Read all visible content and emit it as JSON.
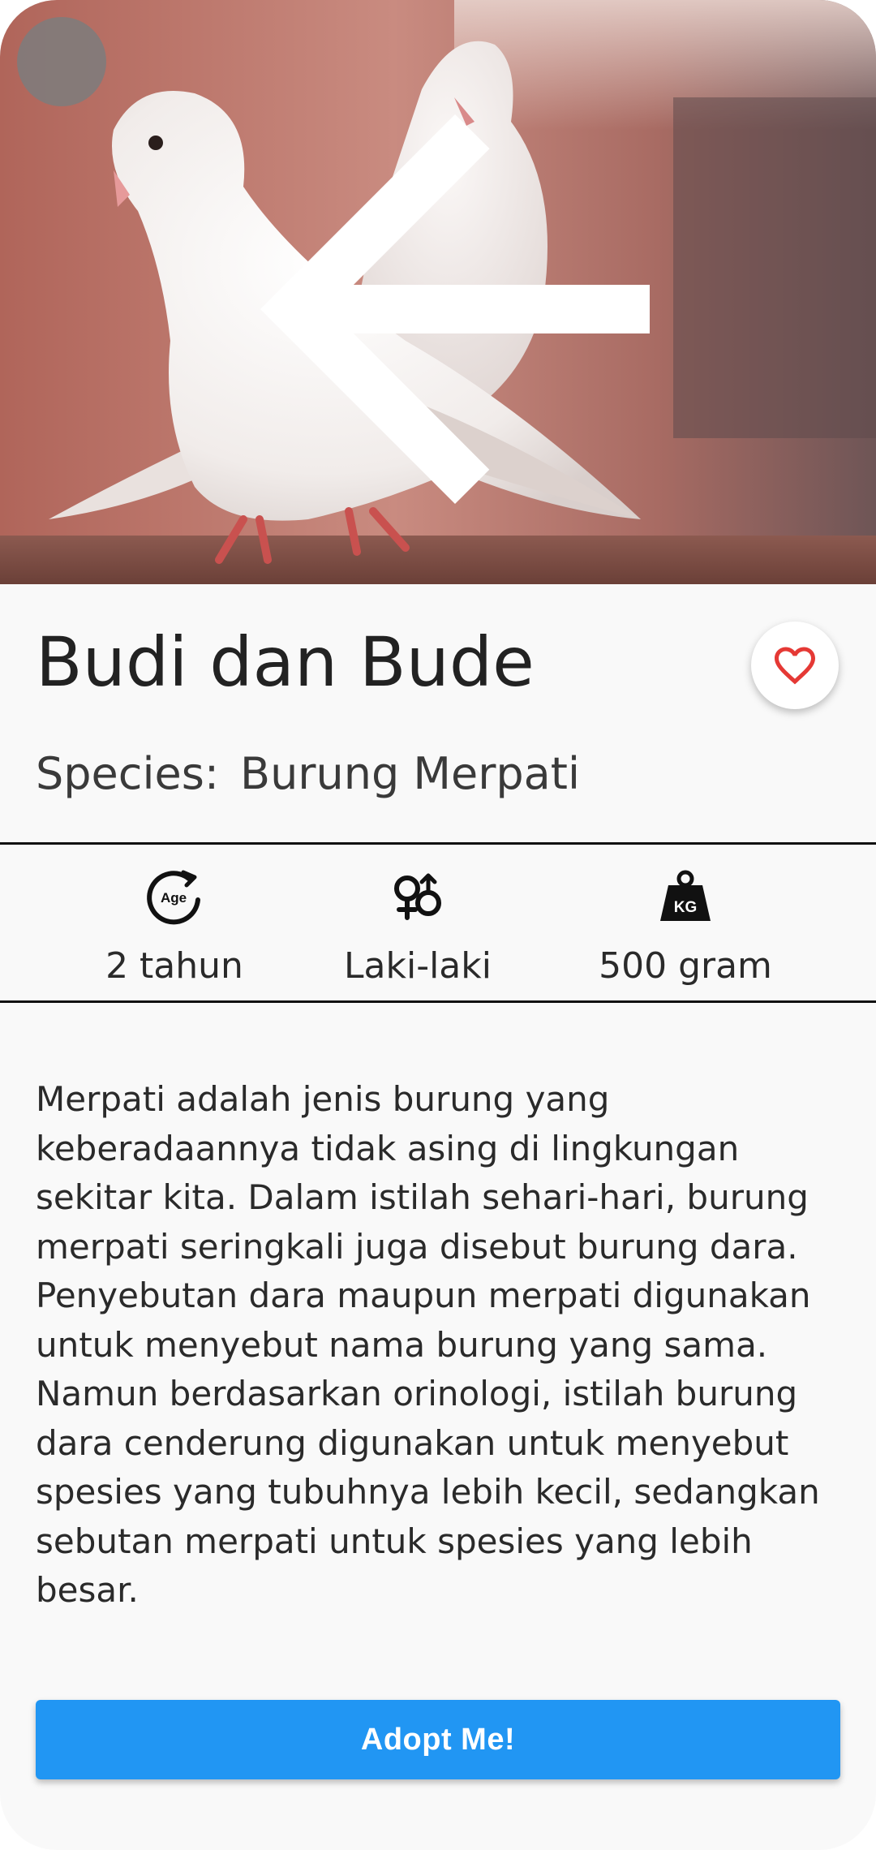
{
  "pet": {
    "name": "Budi dan Bude",
    "species_label": "Species:",
    "species_value": "Burung Merpati",
    "image_icon": "pigeon-photo"
  },
  "attributes": [
    {
      "icon": "age-icon",
      "icon_text": "Age",
      "label": "2 tahun"
    },
    {
      "icon": "gender-icon",
      "label": "Laki-laki"
    },
    {
      "icon": "weight-icon",
      "icon_text": "KG",
      "label": "500 gram"
    }
  ],
  "description": "Merpati adalah jenis burung yang keberadaannya tidak asing di lingkungan sekitar kita. Dalam istilah sehari-hari, burung merpati seringkali juga disebut burung dara. Penyebutan dara maupun merpati digunakan untuk menyebut nama burung yang sama. Namun berdasarkan orinologi, istilah burung dara cenderung digunakan untuk menyebut spesies yang tubuhnya lebih kecil, sedangkan sebutan merpati untuk spesies yang lebih besar.",
  "actions": {
    "back_icon": "arrow-left-icon",
    "favorite_icon": "heart-outline-icon",
    "adopt_label": "Adopt Me!"
  },
  "colors": {
    "accent": "#2196f3",
    "favorite": "#e53935",
    "background": "#f9f9f9"
  }
}
